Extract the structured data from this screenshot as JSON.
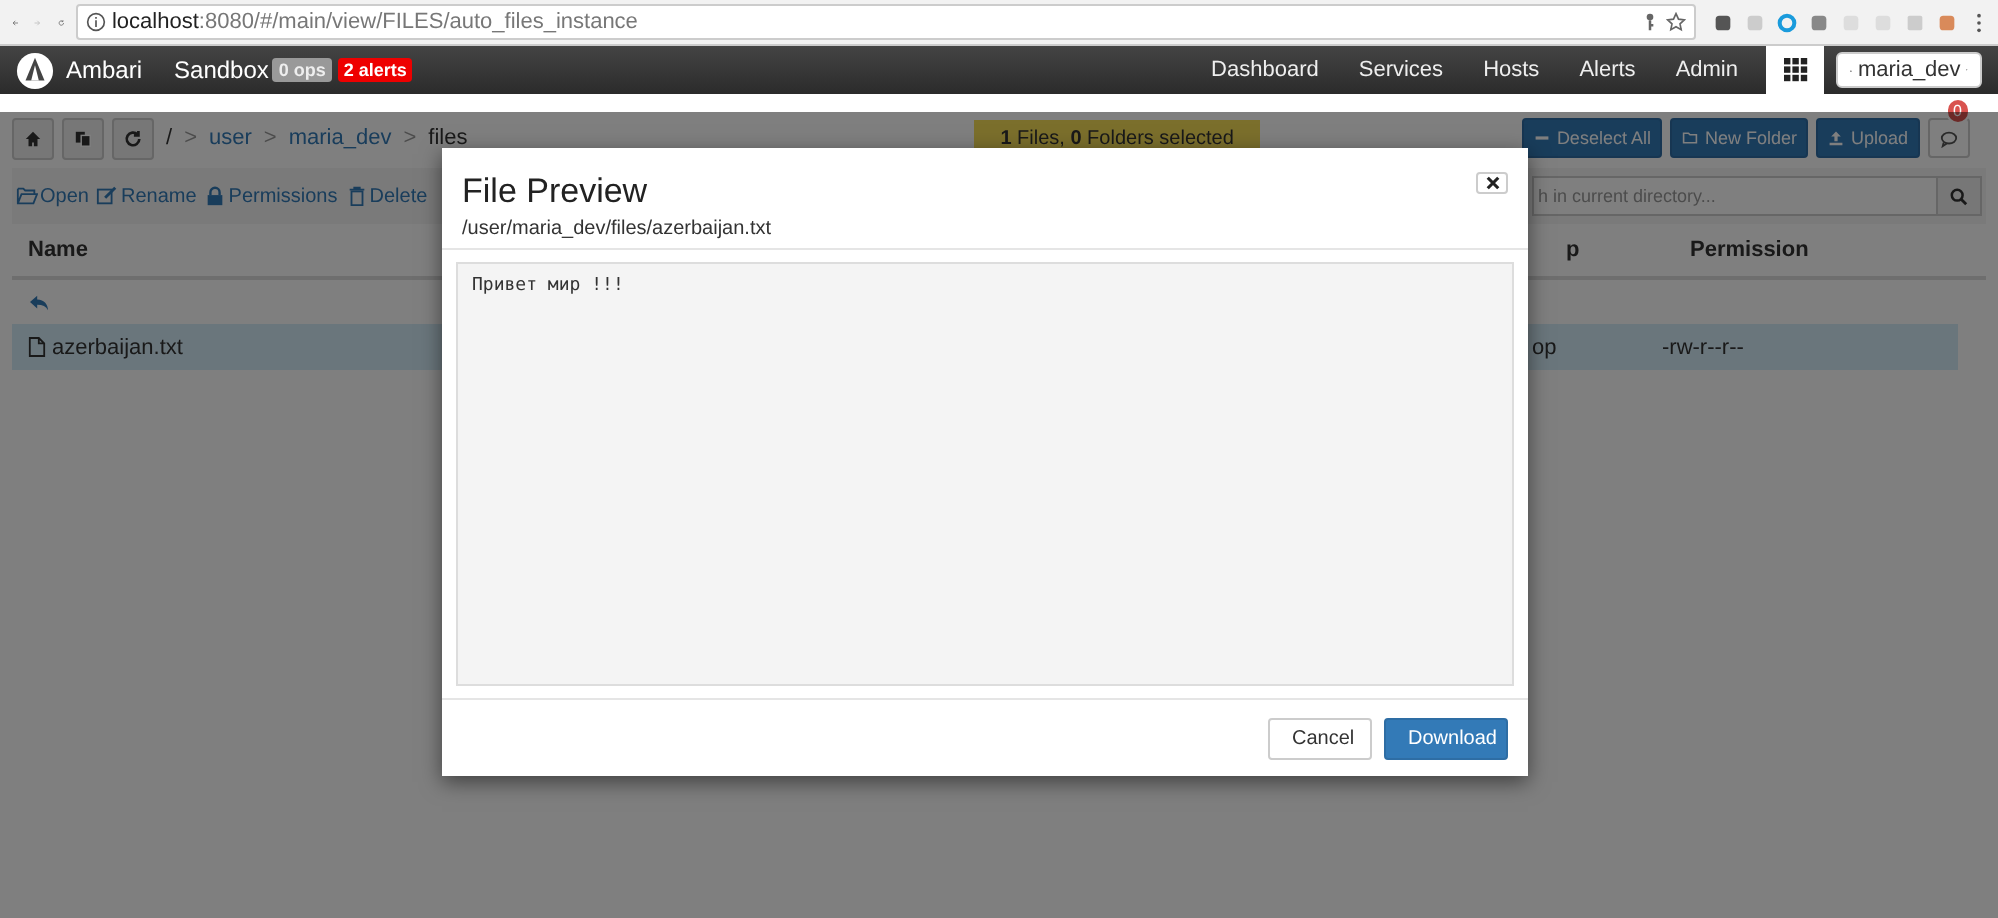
{
  "browser": {
    "url_host": "localhost",
    "url_rest": ":8080/#/main/view/FILES/auto_files_instance"
  },
  "navbar": {
    "brand": "Ambari",
    "cluster": "Sandbox",
    "ops_badge": "0 ops",
    "alerts_badge": "2 alerts",
    "links": [
      "Dashboard",
      "Services",
      "Hosts",
      "Alerts",
      "Admin"
    ],
    "user": "maria_dev"
  },
  "toolbar": {
    "separator": ">",
    "breadcrumb": [
      {
        "label": "/",
        "kind": "text"
      },
      {
        "label": "user",
        "kind": "link"
      },
      {
        "label": "maria_dev",
        "kind": "link"
      },
      {
        "label": "files",
        "kind": "text"
      }
    ],
    "selection": "**1** Files, **0** Folders selected",
    "buttons": [
      {
        "label": "Deselect All"
      },
      {
        "label": "New Folder"
      },
      {
        "label": "Upload"
      }
    ],
    "notifications": "0"
  },
  "actions": [
    {
      "label": "Open"
    },
    {
      "label": "Rename"
    },
    {
      "label": "Permissions"
    },
    {
      "label": "Delete"
    }
  ],
  "search": {
    "placeholder": "h in current directory..."
  },
  "table": {
    "columns": [
      "Name",
      "p",
      "Permission"
    ],
    "rows": [
      {
        "name": "azerbaijan.txt",
        "column_2": "op",
        "permission": "-rw-r--r--",
        "selected": true
      }
    ]
  },
  "modal": {
    "title": "File Preview",
    "path": "/user/maria_dev/files/azerbaijan.txt",
    "content": "Привет мир !!!",
    "buttons": [
      {
        "label": "Cancel",
        "kind": "default"
      },
      {
        "label": "Download",
        "kind": "primary"
      }
    ]
  }
}
